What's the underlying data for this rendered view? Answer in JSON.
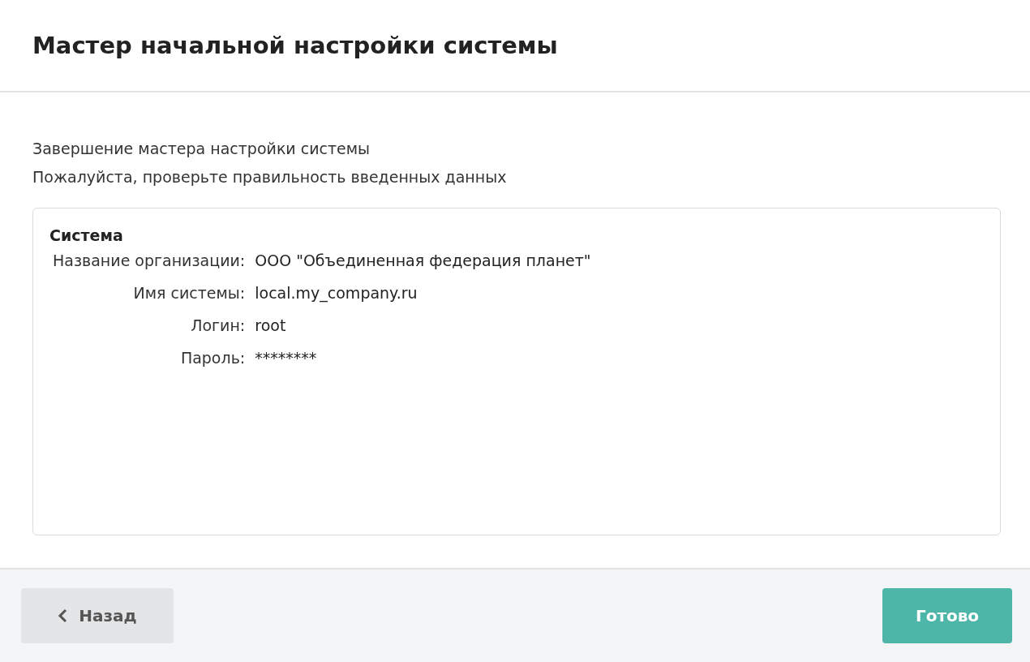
{
  "header": {
    "title": "Мастер начальной настройки системы"
  },
  "intro": [
    "Завершение мастера настройки системы",
    "Пожалуйста, проверьте правильность введенных данных"
  ],
  "summary": {
    "section": "Система",
    "rows": [
      {
        "label": "Название организации:",
        "value": "ООО \"Объединенная федерация планет\""
      },
      {
        "label": "Имя системы:",
        "value": "local.my_company.ru"
      },
      {
        "label": "Логин:",
        "value": "root"
      },
      {
        "label": "Пароль:",
        "value": "********"
      }
    ]
  },
  "footer": {
    "back": "Назад",
    "done": "Готово"
  }
}
